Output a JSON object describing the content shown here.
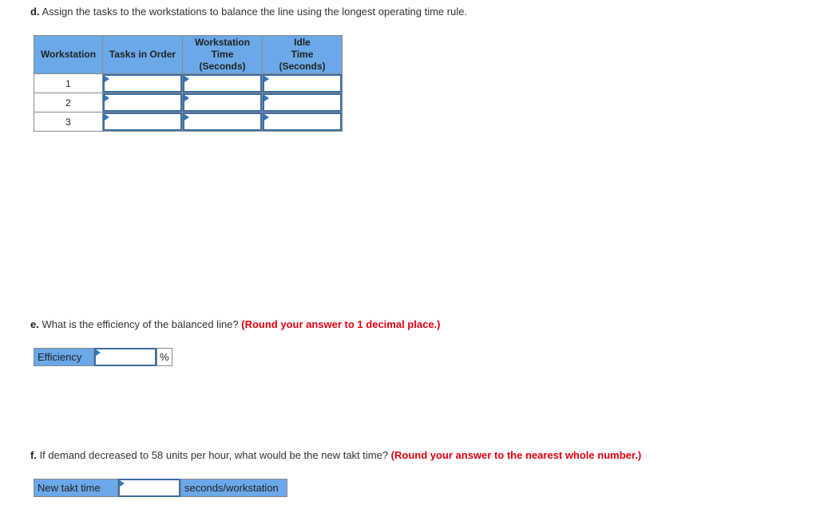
{
  "part_d": {
    "letter": "d.",
    "question": " Assign the tasks to the workstations to balance the line using the longest operating time rule.",
    "table": {
      "headers": {
        "workstation": "Workstation",
        "tasks": "Tasks in Order",
        "ws_time_line1": "Workstation",
        "ws_time_line2": "Time",
        "ws_time_line3": "(Seconds)",
        "idle_line1": "Idle",
        "idle_line2": "Time",
        "idle_line3": "(Seconds)"
      },
      "rows": [
        {
          "workstation": "1",
          "tasks": "",
          "ws_time": "",
          "idle_time": ""
        },
        {
          "workstation": "2",
          "tasks": "",
          "ws_time": "",
          "idle_time": ""
        },
        {
          "workstation": "3",
          "tasks": "",
          "ws_time": "",
          "idle_time": ""
        }
      ]
    }
  },
  "part_e": {
    "letter": "e.",
    "question": " What is the efficiency of the balanced line? ",
    "instruction": "(Round your answer to 1 decimal place.)",
    "label": "Efficiency",
    "value": "",
    "unit": "%"
  },
  "part_f": {
    "letter": "f.",
    "question": " If demand decreased to 58 units per hour, what would be the new takt time? ",
    "instruction": "(Round your answer to the nearest whole number.)",
    "label": "New takt time",
    "value": "",
    "unit": "seconds/workstation"
  },
  "colors": {
    "header_blue": "#6aa8e8",
    "input_border": "#3a6ea5",
    "instruction_red": "#e0000f"
  }
}
